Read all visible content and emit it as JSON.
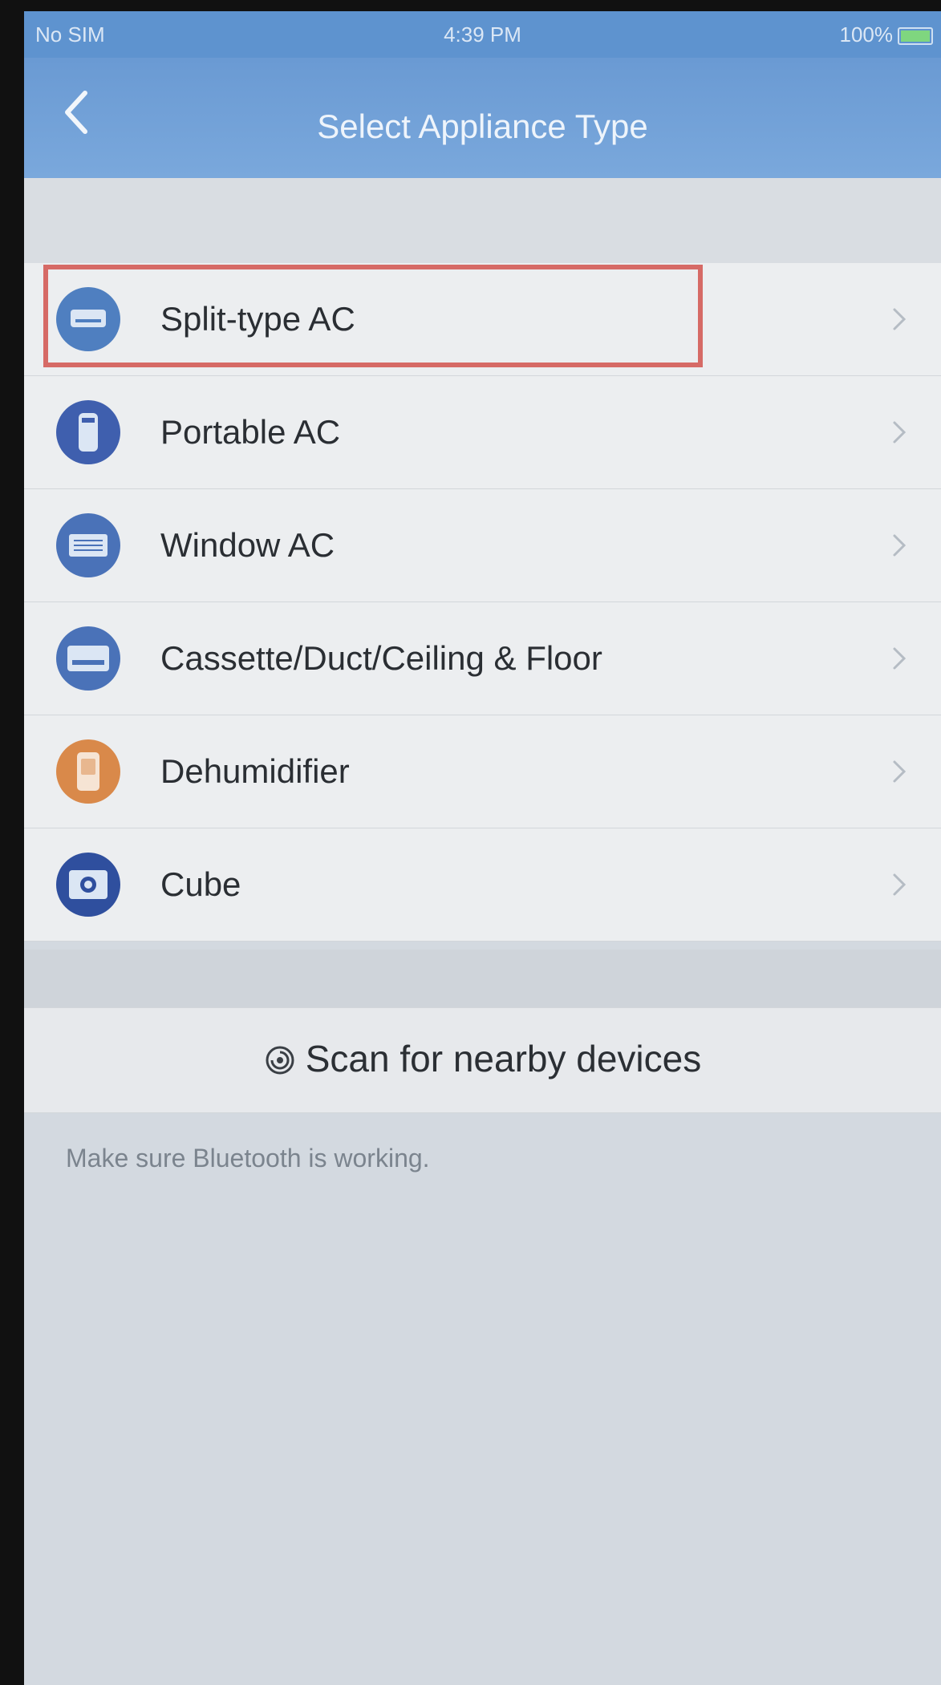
{
  "status_bar": {
    "carrier": "No SIM",
    "time": "4:39 PM",
    "battery": "100%"
  },
  "nav": {
    "title": "Select Appliance Type",
    "back_icon": "chevron-left-icon"
  },
  "appliances": [
    {
      "label": "Split-type AC",
      "icon": "split-ac-icon",
      "color": "#4f7fc0",
      "selected": true
    },
    {
      "label": "Portable AC",
      "icon": "portable-ac-icon",
      "color": "#3f5fae"
    },
    {
      "label": "Window AC",
      "icon": "window-ac-icon",
      "color": "#4a72b8"
    },
    {
      "label": "Cassette/Duct/Ceiling & Floor",
      "icon": "cassette-ac-icon",
      "color": "#4a72b8"
    },
    {
      "label": "Dehumidifier",
      "icon": "dehumidifier-icon",
      "color": "#d9894a"
    },
    {
      "label": "Cube",
      "icon": "cube-icon",
      "color": "#2f4f9e"
    }
  ],
  "scan": {
    "label": "Scan for nearby devices",
    "icon": "scan-icon"
  },
  "footer": {
    "note": "Make sure Bluetooth is working."
  },
  "colors": {
    "nav_background": "#6a9ad3",
    "highlight_border": "#d66a66",
    "list_background": "#eceef0"
  }
}
